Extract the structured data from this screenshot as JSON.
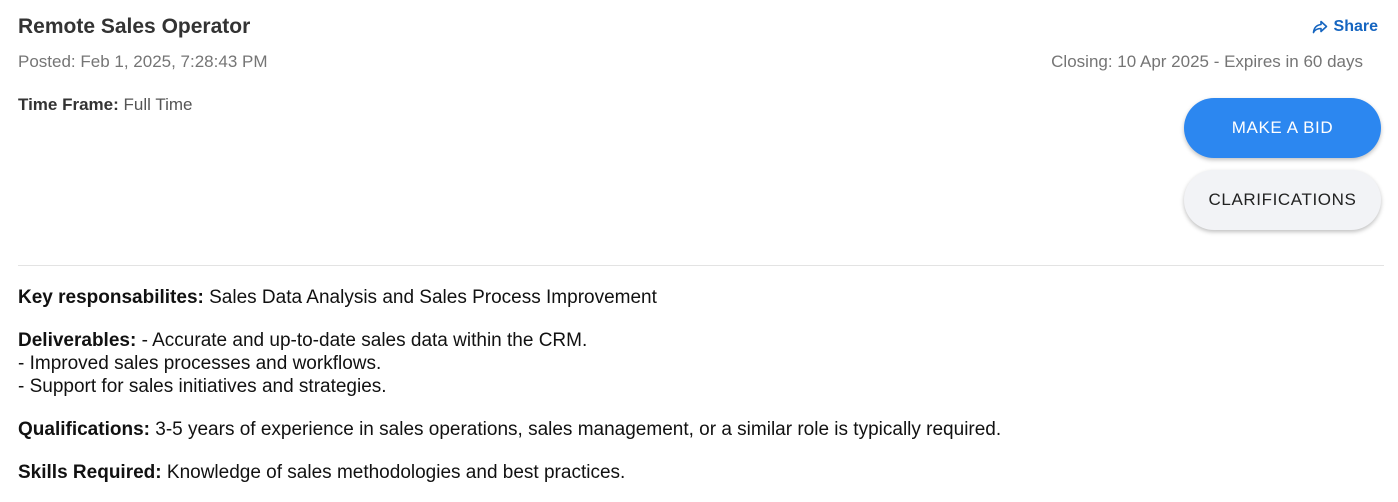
{
  "job": {
    "title": "Remote Sales Operator",
    "posted": "Posted: Feb 1, 2025, 7:28:43 PM",
    "closing": "Closing: 10 Apr 2025 - Expires in 60 days",
    "time_frame_label": "Time Frame:",
    "time_frame_value": "Full Time"
  },
  "share": {
    "label": "Share",
    "icon": "share-arrow-icon",
    "color": "#1565c0"
  },
  "actions": {
    "bid_label": "MAKE A BID",
    "clarifications_label": "CLARIFICATIONS",
    "bid_color": "#2c87f0"
  },
  "details": {
    "key_responsibilities_label": "Key responsabilites:",
    "key_responsibilities_value": "Sales Data Analysis and Sales Process Improvement",
    "deliverables_label": "Deliverables:",
    "deliverables_lines": [
      "- Accurate and up-to-date sales data within the CRM.",
      "- Improved sales processes and workflows.",
      "- Support for sales initiatives and strategies."
    ],
    "qualifications_label": "Qualifications:",
    "qualifications_value": "3-5 years of experience in sales operations, sales management, or a similar role is typically required.",
    "skills_label": "Skills Required:",
    "skills_value": "Knowledge of sales methodologies and best practices."
  }
}
